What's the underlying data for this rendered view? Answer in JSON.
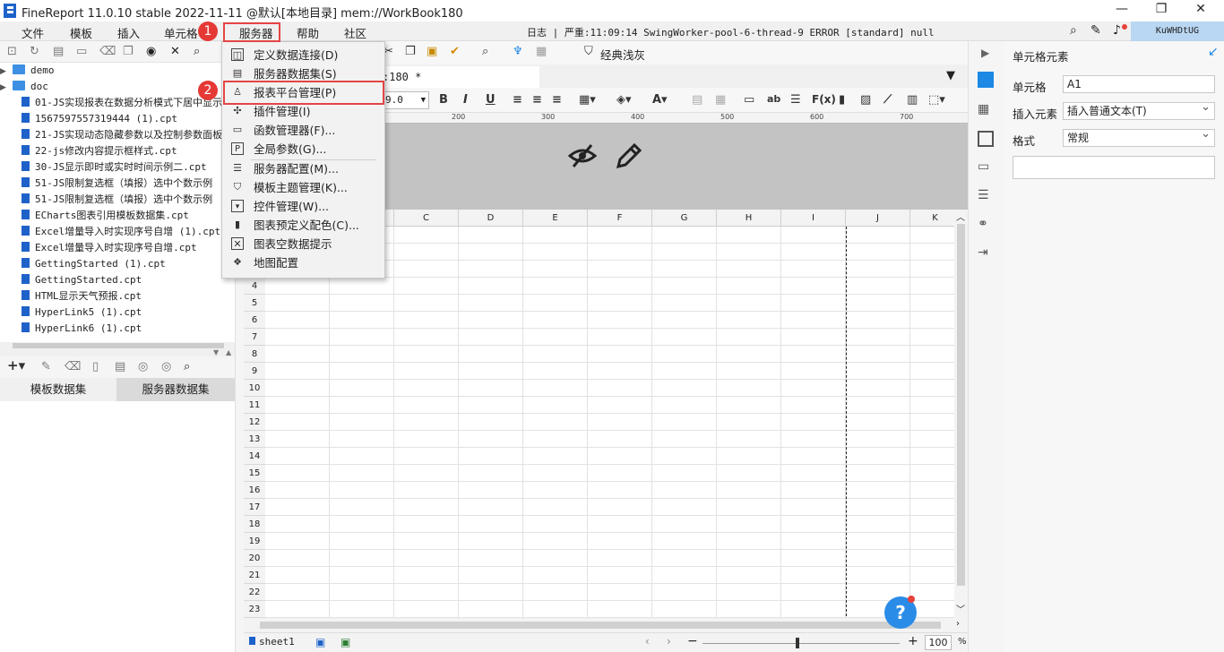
{
  "window": {
    "title": "FineReport 11.0.10 stable 2022-11-11 @默认[本地目录]    mem://WorkBook180",
    "min": "—",
    "max": "❐",
    "close": "✕"
  },
  "menubar": {
    "items": [
      "文件",
      "模板",
      "插入",
      "单元格",
      "服务器",
      "帮助",
      "社区"
    ],
    "log": "日志 | 严重:11:09:14 SwingWorker-pool-6-thread-9 ERROR [standard] null",
    "user": "KuWHDtUG"
  },
  "tree": {
    "folders": [
      "demo",
      "doc"
    ],
    "files": [
      "01-JS实现报表在数据分析模式下居中显示",
      "1567597557319444 (1).cpt",
      "21-JS实现动态隐藏参数以及控制参数面板",
      "22-js修改内容提示框样式.cpt",
      "30-JS显示即时或实时时间示例二.cpt",
      "51-JS限制复选框（填报）选中个数示例",
      "51-JS限制复选框（填报）选中个数示例",
      "ECharts图表引用模板数据集.cpt",
      "Excel增量导入时实现序号自增 (1).cpt",
      "Excel增量导入时实现序号自增.cpt",
      "GettingStarted (1).cpt",
      "GettingStarted.cpt",
      "HTML显示天气预报.cpt",
      "HyperLink5 (1).cpt",
      "HyperLink6 (1).cpt"
    ]
  },
  "dataset_tabs": {
    "template": "模板数据集",
    "server": "服务器数据集"
  },
  "toolbar": {
    "classic_gray": "经典浅灰"
  },
  "doc_tab": {
    "label": ":180 *"
  },
  "format": {
    "font_size": "9.0"
  },
  "ruler": {
    "labels": [
      "200",
      "300",
      "400",
      "500",
      "600",
      "700"
    ]
  },
  "grid": {
    "columns": [
      "C",
      "D",
      "E",
      "F",
      "G",
      "H",
      "I",
      "J",
      "K"
    ],
    "rows": [
      "4",
      "5",
      "6",
      "7",
      "8",
      "9",
      "10",
      "11",
      "12",
      "13",
      "14",
      "15",
      "16",
      "17",
      "18",
      "19",
      "20",
      "21",
      "22",
      "23"
    ]
  },
  "status": {
    "sheet": "sheet1",
    "zoom": "100",
    "zoom_unit": "%",
    "minus": "−",
    "plus": "+"
  },
  "dropdown": {
    "items": [
      "定义数据连接(D)",
      "服务器数据集(S)",
      "报表平台管理(P)",
      "插件管理(I)",
      "函数管理器(F)...",
      "全局参数(G)...",
      "服务器配置(M)...",
      "模板主题管理(K)...",
      "控件管理(W)...",
      "图表预定义配色(C)...",
      "图表空数据提示",
      "地图配置"
    ]
  },
  "callouts": [
    "1",
    "2"
  ],
  "right_panel": {
    "title": "单元格元素",
    "cell_label": "单元格",
    "cell_value": "A1",
    "insert_label": "插入元素",
    "insert_value": "插入普通文本(T)",
    "format_label": "格式",
    "format_value": "常规"
  },
  "help": {
    "label": "?"
  }
}
